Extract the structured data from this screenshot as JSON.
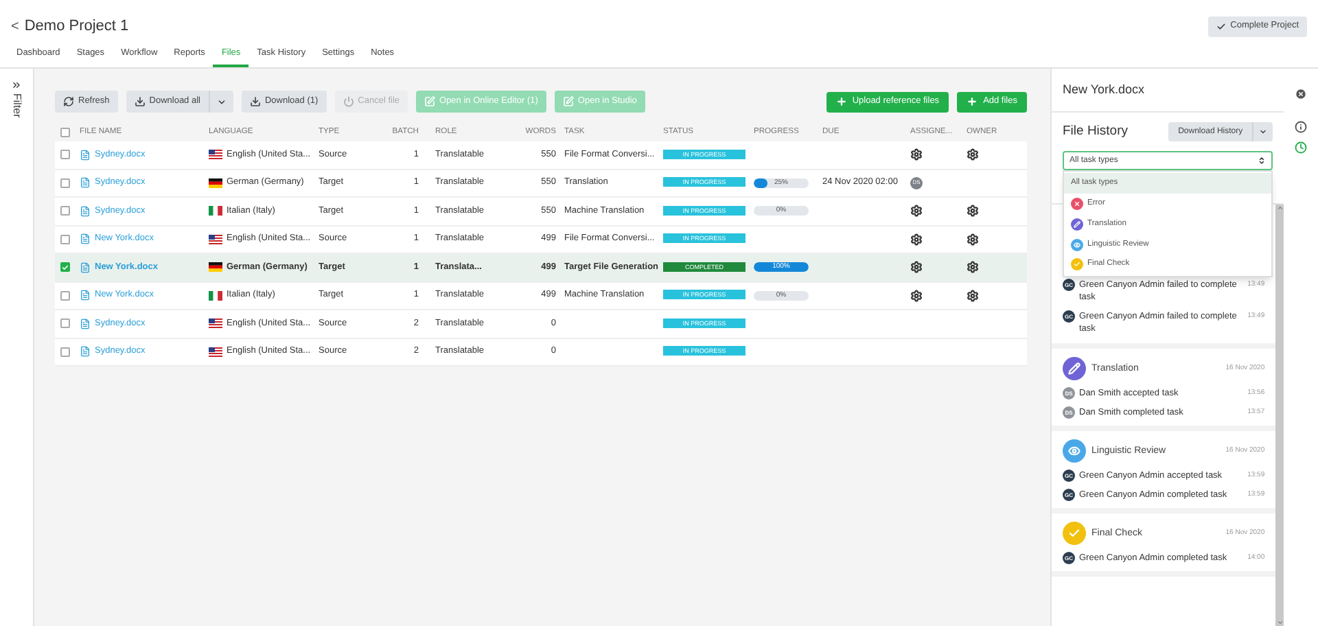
{
  "header": {
    "back": "<",
    "title": "Demo Project 1",
    "action": "Complete Project"
  },
  "tabs": [
    {
      "label": "Dashboard",
      "selected": false
    },
    {
      "label": "Stages",
      "selected": false
    },
    {
      "label": "Workflow",
      "selected": false
    },
    {
      "label": "Reports",
      "selected": false
    },
    {
      "label": "Files",
      "selected": true
    },
    {
      "label": "Task History",
      "selected": false
    },
    {
      "label": "Settings",
      "selected": false
    },
    {
      "label": "Notes",
      "selected": false
    }
  ],
  "filter": {
    "label": "Filter"
  },
  "toolbar": [
    {
      "label": "Refresh",
      "kind": "refresh",
      "disabled": false
    },
    {
      "label": "Download all",
      "kind": "download-split",
      "disabled": false
    },
    {
      "label": "Download (1)",
      "kind": "download",
      "disabled": false
    },
    {
      "label": "Cancel file",
      "kind": "power",
      "disabled": true
    },
    {
      "label": "Open in Online Editor (1)",
      "kind": "edit",
      "disabled": true
    },
    {
      "label": "Open in Studio",
      "kind": "edit",
      "disabled": true
    }
  ],
  "toolbar_right": [
    {
      "label": "Upload reference files"
    },
    {
      "label": "Add files"
    }
  ],
  "table": {
    "columns": [
      "FILE NAME",
      "LANGUAGE",
      "TYPE",
      "BATCH",
      "ROLE",
      "WORDS",
      "TASK",
      "STATUS",
      "PROGRESS",
      "DUE",
      "ASSIGNE...",
      "OWNER"
    ],
    "all_checked": false,
    "rows": [
      {
        "checked": false,
        "selected": false,
        "file": "Sydney.docx",
        "language": {
          "kind": "us",
          "text": "English (United Sta..."
        },
        "type": "Source",
        "batch": "1",
        "role": "Translatable",
        "words": "550",
        "task": "File Format Conversi...",
        "status": {
          "kind": "progress",
          "text": "IN PROGRESS"
        },
        "assignee": {
          "kind": "gear"
        },
        "owner": {
          "kind": "gear"
        }
      },
      {
        "checked": false,
        "selected": false,
        "file": "Sydney.docx",
        "language": {
          "kind": "de",
          "text": "German (Germany)"
        },
        "type": "Target",
        "batch": "1",
        "role": "Translatable",
        "words": "550",
        "task": "Translation",
        "status": {
          "kind": "progress",
          "text": "IN PROGRESS"
        },
        "progress": {
          "level": 0.25,
          "reading": "25%"
        },
        "due": "24 Nov 2020 02:00",
        "assignee": {
          "kind": "avatar",
          "initials": "DS"
        }
      },
      {
        "checked": false,
        "selected": false,
        "file": "Sydney.docx",
        "language": {
          "kind": "it",
          "text": "Italian (Italy)"
        },
        "type": "Target",
        "batch": "1",
        "role": "Translatable",
        "words": "550",
        "task": "Machine Translation",
        "status": {
          "kind": "progress",
          "text": "IN PROGRESS"
        },
        "progress": {
          "level": 0,
          "reading": "0%"
        },
        "assignee": {
          "kind": "gear"
        },
        "owner": {
          "kind": "gear"
        }
      },
      {
        "checked": false,
        "selected": false,
        "file": "New York.docx",
        "language": {
          "kind": "us",
          "text": "English (United Sta..."
        },
        "type": "Source",
        "batch": "1",
        "role": "Translatable",
        "words": "499",
        "task": "File Format Conversi...",
        "status": {
          "kind": "progress",
          "text": "IN PROGRESS"
        },
        "assignee": {
          "kind": "gear"
        },
        "owner": {
          "kind": "gear"
        }
      },
      {
        "checked": true,
        "selected": true,
        "file": "New York.docx",
        "language": {
          "kind": "de",
          "text": "German (Germany)"
        },
        "type": "Target",
        "batch": "1",
        "role": "Translata...",
        "words": "499",
        "task": "Target File Generation",
        "status": {
          "kind": "completed",
          "text": "COMPLETED"
        },
        "progress": {
          "level": 1,
          "reading": "100%"
        },
        "assignee": {
          "kind": "gear"
        },
        "owner": {
          "kind": "gear"
        }
      },
      {
        "checked": false,
        "selected": false,
        "file": "New York.docx",
        "language": {
          "kind": "it",
          "text": "Italian (Italy)"
        },
        "type": "Target",
        "batch": "1",
        "role": "Translatable",
        "words": "499",
        "task": "Machine Translation",
        "status": {
          "kind": "progress",
          "text": "IN PROGRESS"
        },
        "progress": {
          "level": 0,
          "reading": "0%"
        },
        "assignee": {
          "kind": "gear"
        },
        "owner": {
          "kind": "gear"
        }
      },
      {
        "checked": false,
        "selected": false,
        "file": "Sydney.docx",
        "language": {
          "kind": "us",
          "text": "English (United Sta..."
        },
        "type": "Source",
        "batch": "2",
        "role": "Translatable",
        "words": "0",
        "status": {
          "kind": "progress",
          "text": "IN PROGRESS"
        }
      },
      {
        "checked": false,
        "selected": false,
        "file": "Sydney.docx",
        "language": {
          "kind": "us",
          "text": "English (United Sta..."
        },
        "type": "Source",
        "batch": "2",
        "role": "Translatable",
        "words": "0",
        "status": {
          "kind": "progress",
          "text": "IN PROGRESS"
        }
      }
    ]
  },
  "panel": {
    "file": "New York.docx",
    "title": "File History",
    "download": "Download History",
    "side_icons": [
      {
        "kind": "info",
        "selected": false
      },
      {
        "kind": "history",
        "selected": true
      }
    ],
    "select": {
      "value": "All task types",
      "options": [
        {
          "label": "All task types",
          "selected": true
        },
        {
          "label": "Error",
          "kind": "error",
          "color": "#e8506a",
          "selected": false
        },
        {
          "label": "Translation",
          "kind": "translation",
          "color": "#6f63d6",
          "selected": false
        },
        {
          "label": "Linguistic Review",
          "kind": "review",
          "color": "#4aa8e8",
          "selected": false
        },
        {
          "label": "Final Check",
          "kind": "check",
          "color": "#f2c10f",
          "selected": false
        }
      ]
    },
    "sections": [
      {
        "events": [
          {
            "initials": "GC",
            "kind": "dark",
            "text": "Green Canyon Admin failed to complete task",
            "time": "13:49"
          },
          {
            "initials": "GC",
            "kind": "dark",
            "text": "Green Canyon Admin failed to complete task",
            "time": "13:49"
          }
        ]
      },
      {
        "title": "Translation",
        "kind": "translation",
        "color": "#6f63d6",
        "date": "16 Nov 2020",
        "events": [
          {
            "initials": "DS",
            "kind": "light",
            "text": "Dan Smith accepted task",
            "time": "13:56"
          },
          {
            "initials": "DS",
            "kind": "light",
            "text": "Dan Smith completed task",
            "time": "13:57"
          }
        ]
      },
      {
        "title": "Linguistic Review",
        "kind": "review",
        "color": "#4aa8e8",
        "date": "16 Nov 2020",
        "events": [
          {
            "initials": "GC",
            "kind": "dark",
            "text": "Green Canyon Admin accepted task",
            "time": "13:59"
          },
          {
            "initials": "GC",
            "kind": "dark",
            "text": "Green Canyon Admin completed task",
            "time": "13:59"
          }
        ]
      },
      {
        "title": "Final Check",
        "kind": "check",
        "color": "#f2c10f",
        "date": "16 Nov 2020",
        "events": [
          {
            "initials": "GC",
            "kind": "dark",
            "text": "Green Canyon Admin completed task",
            "time": "14:00"
          }
        ]
      }
    ]
  }
}
